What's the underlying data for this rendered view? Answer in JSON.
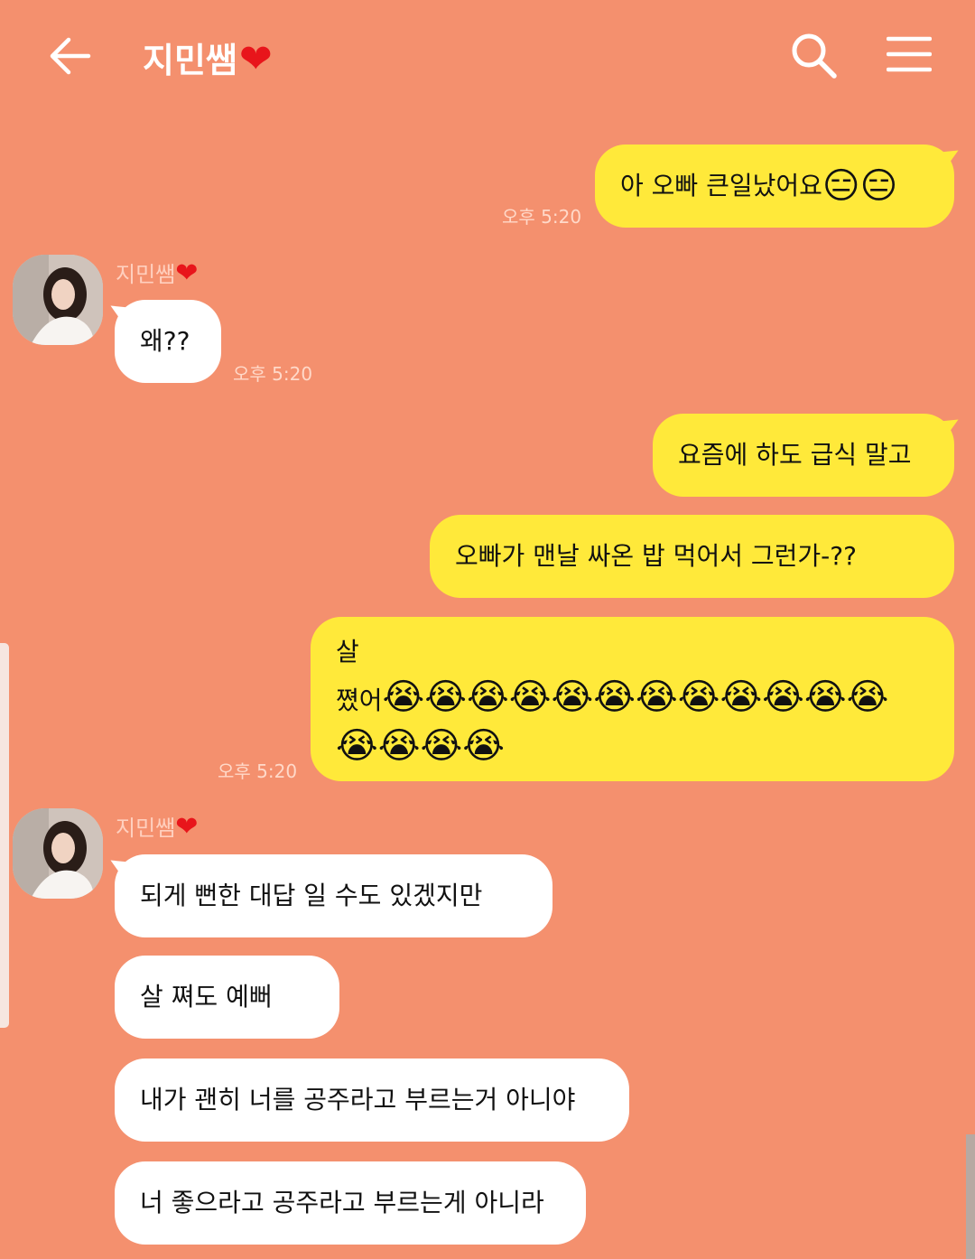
{
  "header": {
    "title": "지민쌤",
    "title_heart": "❤",
    "back_icon": "arrow-left-icon",
    "search_icon": "search-icon",
    "menu_icon": "hamburger-menu-icon"
  },
  "colors": {
    "background": "#f4906e",
    "my_bubble": "#ffe93a",
    "their_bubble": "#ffffff"
  },
  "messages": {
    "m1": {
      "text": "아 오빠 큰일났어요",
      "emoji": "😑😑",
      "time": "오후 5:20"
    },
    "sender1": {
      "name": "지민쌤",
      "heart": "❤"
    },
    "m2": {
      "text": "왜??",
      "time": "오후 5:20"
    },
    "m3": {
      "text": "요즘에 하도 급식 말고"
    },
    "m4": {
      "text": "오빠가 맨날 싸온 밥 먹어서 그런가-??"
    },
    "m5": {
      "line1": "살",
      "line2": "쪘어",
      "emoji_row1": "😭😭😭😭😭😭😭😭😭😭😭😭",
      "emoji_row2": "😭😭😭😭",
      "time": "오후 5:20"
    },
    "sender2": {
      "name": "지민쌤",
      "heart": "❤"
    },
    "m6": {
      "text": "되게 뻔한 대답 일 수도 있겠지만"
    },
    "m7": {
      "text": "살 쪄도 예뻐"
    },
    "m8": {
      "text": "내가 괜히 너를 공주라고 부르는거 아니야"
    },
    "m9": {
      "text": "너 좋으라고 공주라고 부르는게 아니라"
    }
  }
}
